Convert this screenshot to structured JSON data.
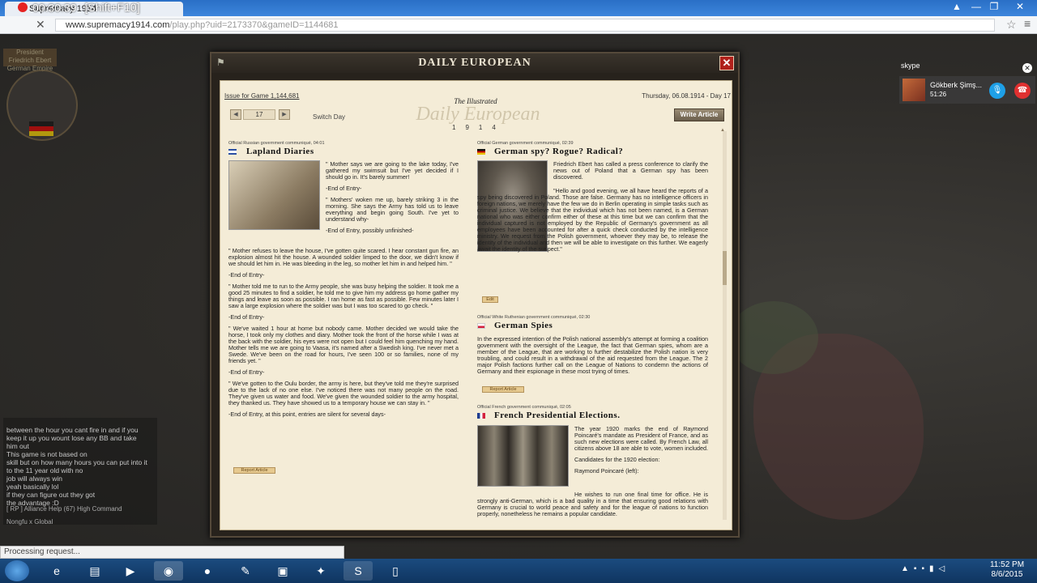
{
  "browser": {
    "tab_title": "Supremacy 1914",
    "recording_timer": "00:30:39",
    "recording_hotkey": "[Shift+F10]",
    "url_main": "www.supremacy1914.com",
    "url_rest": "/play.php?uid=2173370&gameID=1144681"
  },
  "game": {
    "president_label": "President",
    "president_name": "Friedrich Ebert",
    "country": "German Empire"
  },
  "chat": {
    "messages": [
      "between the hour you cant fire in and if you",
      "keep it up you wount lose any BB and take",
      "him out",
      "This game is not based on",
      "skill but on how many hours you can put into it",
      "to the 11 year old with no",
      "job will always win",
      "yeah basically lol",
      "if they can figure out they got",
      "the advantage :D"
    ],
    "tabs_line1": "[ RP ] Alliance   Help (67)   High Command",
    "tabs_line2": "Nongfu x   Global"
  },
  "status_bar": "Processing request...",
  "skype": {
    "logo": "skype",
    "caller_name": "Gökberk Şimş...",
    "call_time": "51:26"
  },
  "window": {
    "title": "DAILY EUROPEAN"
  },
  "newspaper": {
    "issue": "Issue for Game 1,144,681",
    "date": "Thursday, 06.08.1914 - Day 17",
    "masthead_small": "The Illustrated",
    "masthead": "Daily European",
    "masthead_year": "1914",
    "day_value": "17",
    "switch_day": "Switch Day",
    "write_article": "Write Article",
    "articles": [
      {
        "meta": "Official Russian government communiqué, 04:01",
        "headline": "Lapland Diaries",
        "flag_color": "#2b4fa3",
        "paragraphs": [
          "\" Mother says we are going to the lake today, I've gathered my swimsuit but I've yet decided if I should go in. It's barely summer!",
          "-End of Entry-",
          "\" Mothers' woken me up, barely striking 3 in the morning. She says the Army has told us to leave everything and begin going South. I've yet to understand why-",
          "-End of Entry, possibly unfinished-",
          "\" Mother refuses to leave the house, I've gotten quite scared. I hear constant gun fire, an explosion almost hit the house. A wounded soldier limped to the door, we didn't know if we should let him in. He was bleeding in the leg, so mother let him in and helped him. \"",
          "-End of Entry-",
          "\" Mother told me to run to the Army people, she was busy helping the soldier. It took me a good 25 minutes to find a soldier, he told me to give him my address go home gather my things and leave as soon as possible. I ran home as fast as possible. Few minutes later I saw a large explosion where the soldier was but I was too scared to go check. \"",
          "-End of Entry-",
          "\" We've waited 1 hour at home but nobody came. Mother decided we would take the horse, I took only my clothes and diary. Mother took the front of the horse while I was at the back with the soldier, his eyes were not open but I could feel him quenching my hand. Mother tells me we are going to Vaasa, it's named after a Swedish king. I've never met a Swede. We've been on the road for hours, I've seen 100 or so families, none of my friends yet. \"",
          "-End of Entry-",
          "\" We've gotten to the Oulu border, the army is here, but they've told me they're surprised due to the lack of no one else. I've noticed there was not many people on the road. They've given us water and food. We've given the wounded soldier to the army hospital, they thanked us. They have showed us to a temporary house we can stay in. \"",
          "-End of Entry, at this point, entries are silent for several days-"
        ],
        "report": "Report Article"
      },
      {
        "meta": "Official German government communiqué, 02:39",
        "headline": "German spy? Rogue? Radical?",
        "paragraphs": [
          "Friedrich Ebert has called a press conference to clarify the news out of Poland that a German spy has been discovered.",
          "\"Hello and good evening, we all have heard the reports of a spy being discovered in Poland. Those are false. Germany has no intelligence officers in foreign nations, we merely have the few we do in Berlin operating in simple tasks such as criminal justice. We believe that the individual which has not been named, is a German national who was either confirm either of these at this time but we can confirm that the individual captured is not employed by the Republic of Germany's government as all employees have been accounted for after a quick check conducted by the intelligence ministry. We request from the Polish government, whoever they may be, to release the identity of the individual and then we will be able to investigate on this further. We eagerly await the identity of the suspect.\""
        ],
        "edit": "Edit"
      },
      {
        "meta": "Official White Ruthenian government communiqué, 02:30",
        "headline": "German Spies",
        "paragraphs": [
          "In the expressed intention of the Polish national assembly's attempt at forming a coalition government with the oversight of the League, the fact that German spies, whom are a member of the League, that are working to further destabilize the Polish nation is very troubling, and could result in a withdrawal of the aid requested from the League. The 2 major Polish factions further call on the League of Nations to condemn the actions of Germany and their espionage in these most trying of times."
        ],
        "report": "Report Article"
      },
      {
        "meta": "Official French government communiqué, 02:05",
        "headline": "French Presidential Elections.",
        "paragraphs": [
          "The year 1920 marks the end of Raymond Poincaré's mandate as President of France, and as such new elections were called. By French Law, all citizens above 18 are able to vote, women included.",
          "Candidates for the 1920 election:",
          "Raymond Poincaré (left):",
          "He wishes to run one final time for office. He is strongly anti-German, which is a bad quality in a time that ensuring good relations with Germany is crucial to world peace and safety and for the league of nations to function properly, nonetheless he remains a popular candidate."
        ]
      }
    ]
  },
  "taskbar": {
    "time": "11:52 PM",
    "date": "8/6/2015"
  }
}
